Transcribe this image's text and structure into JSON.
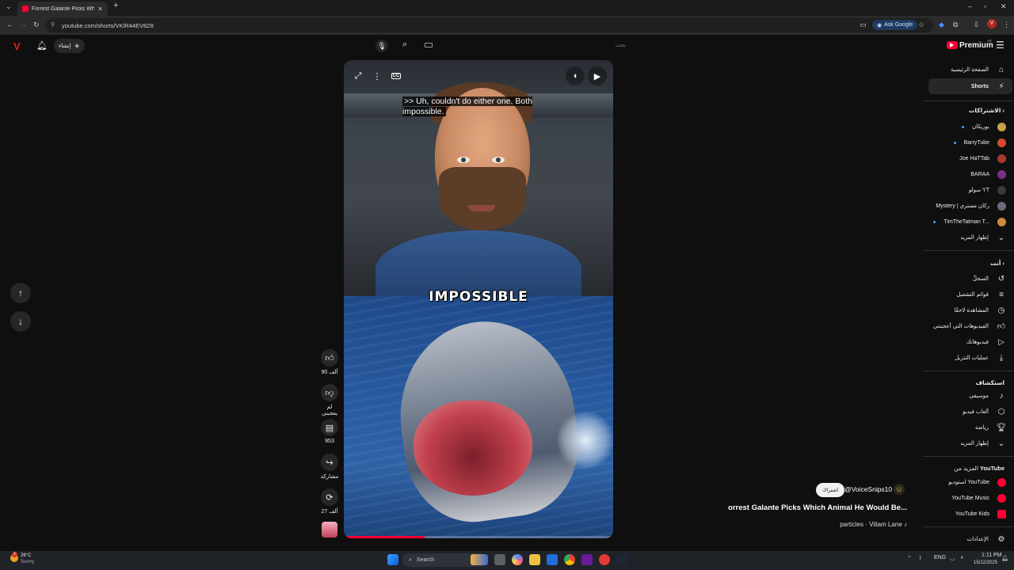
{
  "browser": {
    "tab_title": "Forrest Galante Picks Which Animal He Would Be",
    "tab_close": "✕",
    "new_tab": "+",
    "tab_menu": "⌄",
    "url": "youtube.com/shorts/VKlR44EV8Z8",
    "ask_google": "Ask Google",
    "window_controls": [
      "–",
      "▫",
      "✕"
    ],
    "profile_initial": "V"
  },
  "youtube": {
    "create_label": "إنشاء",
    "search_placeholder": "بحث",
    "premium_label": "Premium",
    "premium_region": "AE"
  },
  "sidebar": {
    "main": [
      {
        "label": "الصفحة الرئيسية",
        "icon": "home-icon"
      },
      {
        "label": "Shorts",
        "icon": "shorts-icon"
      }
    ],
    "subscriptions_header": "الاشتراكات",
    "subscriptions": [
      {
        "label": "بوريكان",
        "color": "#c9a24a",
        "new": true
      },
      {
        "label": "BarryTube",
        "color": "#d9472b",
        "new": true
      },
      {
        "label": "Joe HaTTab",
        "color": "#a83a32",
        "new": false
      },
      {
        "label": "BARAA",
        "color": "#7a2f8a",
        "new": false
      },
      {
        "label": "سولو YT",
        "color": "#3b3b3b",
        "new": false
      },
      {
        "label": "Mystery | ركان مستري",
        "color": "#6b6b7b",
        "new": false
      },
      {
        "label": "TimTheTatman T...",
        "color": "#c98a3a",
        "new": true
      }
    ],
    "show_more": "إظهار المزيد",
    "you_header": "أنت",
    "you": [
      {
        "label": "السجلّ",
        "icon": "history-icon"
      },
      {
        "label": "قوائم التشغيل",
        "icon": "playlists-icon"
      },
      {
        "label": "المشاهدة لاحقًا",
        "icon": "watch-later-icon"
      },
      {
        "label": "الفيديوهات التي أعجبتني",
        "icon": "liked-icon"
      },
      {
        "label": "فيديوهاتك",
        "icon": "your-videos-icon"
      },
      {
        "label": "عمليات التنزيل",
        "icon": "downloads-icon"
      }
    ],
    "explore_header": "استكشاف",
    "explore": [
      {
        "label": "موسيقى",
        "icon": "music-icon"
      },
      {
        "label": "ألعاب فيديو",
        "icon": "gaming-icon"
      },
      {
        "label": "رياضة",
        "icon": "sports-icon"
      }
    ],
    "explore_more": "إظهار المزيد",
    "more_header_prefix": "المزيد من",
    "more_header_brand": "YouTube",
    "more_from": [
      {
        "label": "استوديو YouTube"
      },
      {
        "label": "YouTube Music"
      },
      {
        "label": "YouTube Kids"
      }
    ],
    "settings": "الإعدادات"
  },
  "video": {
    "caption": ">> Uh, couldn't do either one. Both impossible.",
    "overlay_text": "IMPOSSIBLE",
    "progress": 0.3
  },
  "actions": {
    "likes": "90 ألف",
    "dislike": "لم يعجبني",
    "comments": "953",
    "share": "مشاركة",
    "remix": "27 ألف"
  },
  "info": {
    "channel": "@VoiceSnips10",
    "subscribe": "اشتراك",
    "title": "orrest Galante Picks Which Animal He Would Be...",
    "music": "particles · Viliam Lane ♪"
  },
  "taskbar": {
    "temperature": "26°C",
    "weather": "Sunny",
    "search": "Search",
    "lang": "ENG",
    "time": "1:11 PM",
    "date": "15/12/2025",
    "notification_count": "1"
  }
}
